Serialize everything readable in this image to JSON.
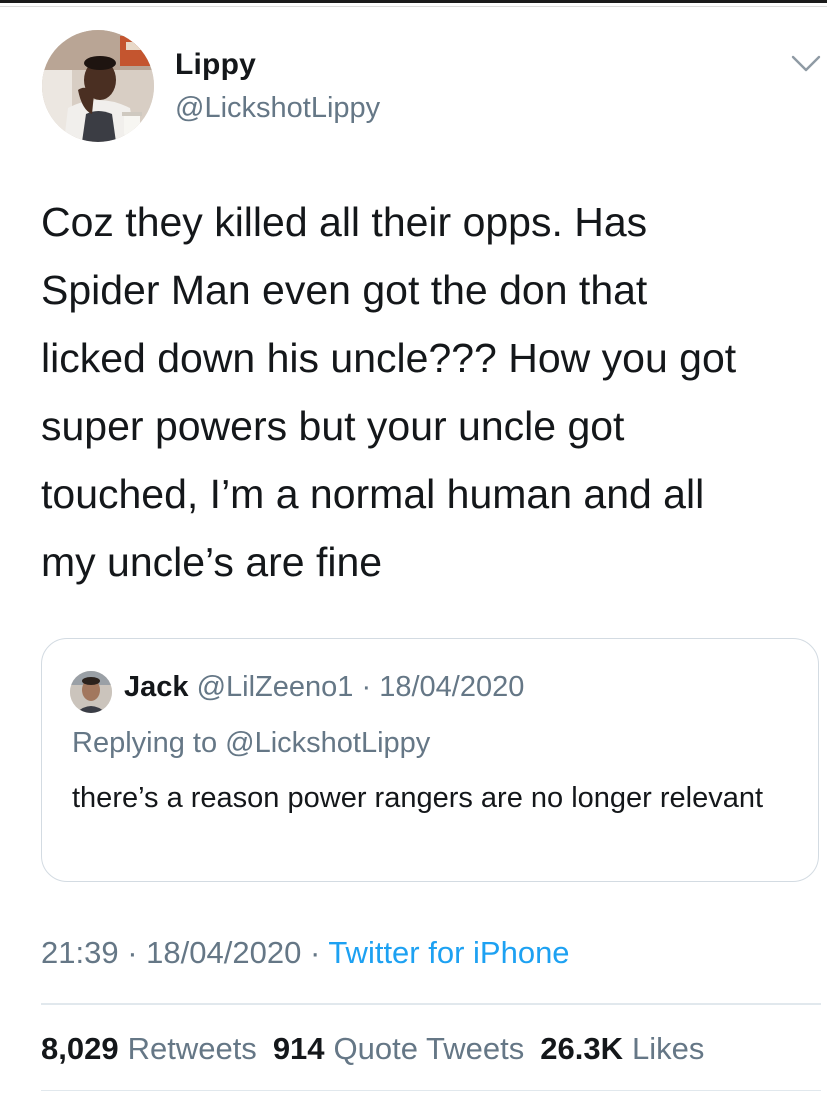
{
  "tweet": {
    "author": {
      "display_name": "Lippy",
      "handle": "@LickshotLippy"
    },
    "menu_icon": "chevron-down-icon",
    "text": "Coz they killed all their opps. Has\nSpider Man even got the don that\nlicked down his uncle??? How you got\nsuper powers but your uncle got\ntouched, I’m a normal human and all\nmy uncle’s are fine",
    "quoted_tweet": {
      "author_name": "Jack",
      "author_handle": "@LilZeeno1",
      "separator": "·",
      "date": "18/04/2020",
      "replying_prefix": "Replying to",
      "replying_to": "@LickshotLippy",
      "text": "there’s a reason power rangers are no longer relevant"
    },
    "timestamp": {
      "time": "21:39",
      "separator": "·",
      "date": "18/04/2020",
      "source": "Twitter for iPhone"
    },
    "stats": {
      "retweets_count": "8,029",
      "retweets_label": "Retweets",
      "quotes_count": "914",
      "quotes_label": "Quote Tweets",
      "likes_count": "26.3K",
      "likes_label": "Likes"
    },
    "colors": {
      "text": "#14171a",
      "secondary": "#657786",
      "link": "#1da1f2",
      "border": "#d3dbe2"
    }
  }
}
